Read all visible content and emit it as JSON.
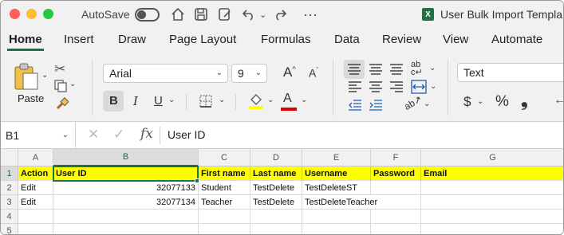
{
  "titlebar": {
    "autosave_label": "AutoSave",
    "document_title": "User Bulk Import Templa",
    "overflow": "···",
    "excel_badge": "X"
  },
  "tabs": [
    "Home",
    "Insert",
    "Draw",
    "Page Layout",
    "Formulas",
    "Data",
    "Review",
    "View",
    "Automate"
  ],
  "ribbon": {
    "paste_label": "Paste",
    "font_name": "Arial",
    "font_size": "9",
    "grow_font": "A",
    "shrink_font": "A",
    "bold": "B",
    "italic": "I",
    "underline": "U",
    "font_color_letter": "A",
    "number_format": "Text",
    "currency": "$",
    "percent": "%",
    "comma": "❟",
    "highlight_color": "#ffff00",
    "font_color": "#e00000"
  },
  "formula_bar": {
    "name_box": "B1",
    "fx": "fx",
    "content": "User ID"
  },
  "sheet": {
    "columns": [
      "A",
      "B",
      "C",
      "D",
      "E",
      "F",
      "G"
    ],
    "rows": [
      "1",
      "2",
      "3",
      "4",
      "5"
    ],
    "header_row": [
      "Action",
      "User ID",
      "First name",
      "Last name",
      "Username",
      "Password",
      "Email"
    ],
    "data_rows": [
      [
        "Edit",
        "32077133",
        "Student",
        "TestDelete",
        "TestDeleteST",
        "",
        ""
      ],
      [
        "Edit",
        "32077134",
        "Teacher",
        "TestDelete",
        "TestDeleteTeacher",
        "",
        ""
      ]
    ],
    "selected_cell": "B1",
    "header_fill": "#ffff00",
    "accent": "#1e7145"
  }
}
